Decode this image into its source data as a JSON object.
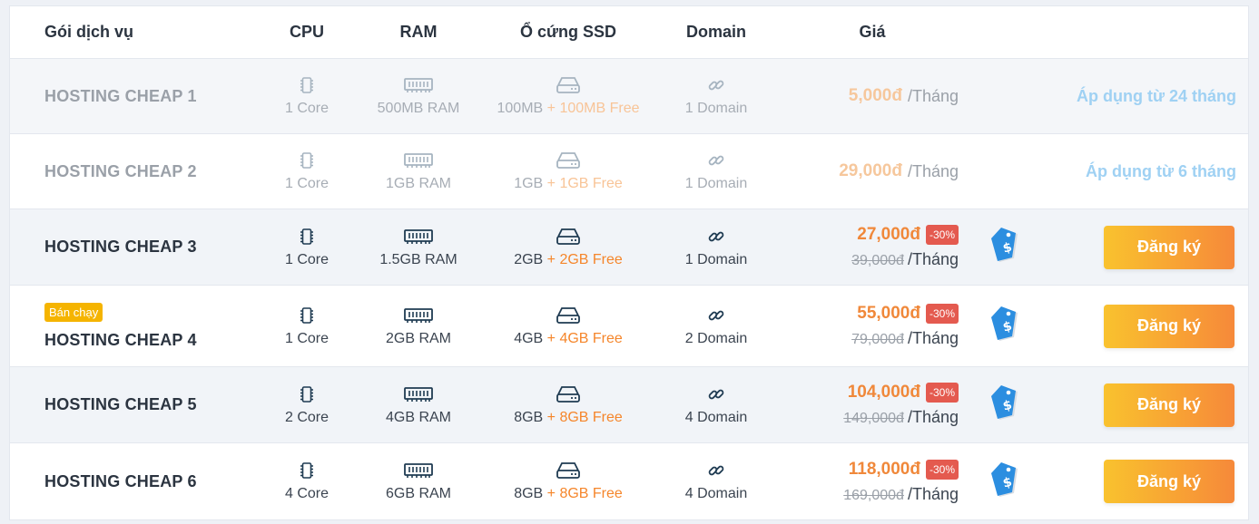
{
  "header": {
    "package": "Gói dịch vụ",
    "cpu": "CPU",
    "ram": "RAM",
    "ssd": "Ổ cứng SSD",
    "domain": "Domain",
    "price": "Giá"
  },
  "colors": {
    "accent_orange": "#f0883a",
    "discount_red": "#e45a4f",
    "badge_yellow": "#f5b400",
    "apply_blue": "#9fd1f3",
    "icon_navy": "#1f3b52"
  },
  "icons": {
    "cpu": "cpu-chip-icon",
    "ram": "ram-module-icon",
    "ssd": "hard-drive-icon",
    "domain": "link-icon",
    "tag": "price-tag-icon"
  },
  "plans": [
    {
      "name": "HOSTING CHEAP 1",
      "cpu": "1 Core",
      "ram": "500MB RAM",
      "ssd": "100MB",
      "ssd_free": "+ 100MB Free",
      "domain": "1 Domain",
      "price": "5,000đ",
      "per": "/Tháng",
      "apply": "Áp dụng từ 24 tháng"
    },
    {
      "name": "HOSTING CHEAP 2",
      "cpu": "1 Core",
      "ram": "1GB RAM",
      "ssd": "1GB",
      "ssd_free": "+ 1GB Free",
      "domain": "1 Domain",
      "price": "29,000đ",
      "per": "/Tháng",
      "apply": "Áp dụng từ 6 tháng"
    },
    {
      "name": "HOSTING CHEAP 3",
      "cpu": "1 Core",
      "ram": "1.5GB RAM",
      "ssd": "2GB",
      "ssd_free": "+ 2GB Free",
      "domain": "1 Domain",
      "price": "27,000đ",
      "discount": "-30%",
      "old_price": "39,000đ",
      "per": "/Tháng",
      "button": "Đăng ký"
    },
    {
      "badge": "Bán chạy",
      "name": "HOSTING CHEAP 4",
      "cpu": "1 Core",
      "ram": "2GB RAM",
      "ssd": "4GB",
      "ssd_free": "+ 4GB Free",
      "domain": "2 Domain",
      "price": "55,000đ",
      "discount": "-30%",
      "old_price": "79,000đ",
      "per": "/Tháng",
      "button": "Đăng ký"
    },
    {
      "name": "HOSTING CHEAP 5",
      "cpu": "2 Core",
      "ram": "4GB RAM",
      "ssd": "8GB",
      "ssd_free": "+ 8GB Free",
      "domain": "4 Domain",
      "price": "104,000đ",
      "discount": "-30%",
      "old_price": "149,000đ",
      "per": "/Tháng",
      "button": "Đăng ký"
    },
    {
      "name": "HOSTING CHEAP 6",
      "cpu": "4 Core",
      "ram": "6GB RAM",
      "ssd": "8GB",
      "ssd_free": "+ 8GB Free",
      "domain": "4 Domain",
      "price": "118,000đ",
      "discount": "-30%",
      "old_price": "169,000đ",
      "per": "/Tháng",
      "button": "Đăng ký"
    }
  ]
}
